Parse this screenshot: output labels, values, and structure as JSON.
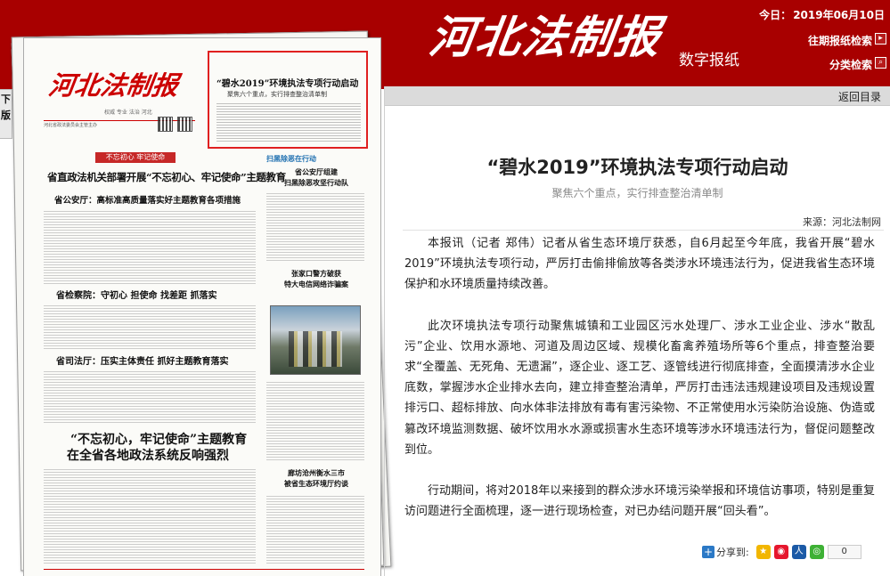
{
  "header": {
    "masthead": "河北法制报",
    "subtitle": "数字报纸",
    "date_label": "今日：",
    "date_value": "2019年06月10日",
    "history_search": "往期报纸检索",
    "category_search": "分类检索"
  },
  "left_tab": "下\n版",
  "newspaper": {
    "masthead": "河北法制报",
    "slogan": "权威 专业 法治 河北",
    "info_line": "河北省政法委员会主管主办",
    "teaser_title": "“碧水2019”环境执法专项行动启动",
    "teaser_subtitle": "聚焦六个重点，实行排查整治清单制",
    "band_left": "不忘初心 牢记使命",
    "band_right": "扫黑除恶在行动",
    "headline_main": "省直政法机关部署开展“不忘初心、牢记使命”主题教育",
    "headline_2": "省公安厅：高标准高质量落实好主题教育各项措施",
    "headline_3": "省检察院：守初心 担使命 找差距 抓落实",
    "headline_4": "省司法厅：压实主体责任 抓好主题教育落实",
    "headline_5": "“不忘初心，牢记使命”主题教育",
    "headline_6": "在全省各地政法系统反响强烈",
    "right_1": "省公安厅组建\n扫黑除恶攻坚行动队",
    "right_2": "张家口警方破获\n特大电信网络诈骗案",
    "right_3": "廊坊沧州衡水三市\n被省生态环境厅约谈"
  },
  "nav": {
    "back_label": "返回目录"
  },
  "article": {
    "title": "“碧水2019”环境执法专项行动启动",
    "subtitle": "聚焦六个重点，实行排查整治清单制",
    "source": "来源：河北法制网",
    "paragraphs": [
      "本报讯（记者 郑伟）记者从省生态环境厅获悉，自6月起至今年底，我省开展“碧水2019”环境执法专项行动，严厉打击偷排偷放等各类涉水环境违法行为，促进我省生态环境保护和水环境质量持续改善。",
      "此次环境执法专项行动聚焦城镇和工业园区污水处理厂、涉水工业企业、涉水“散乱污”企业、饮用水源地、河道及周边区域、规模化畜禽养殖场所等6个重点，排查整治要求“全覆盖、无死角、无遗漏”，逐企业、逐工艺、逐管线进行彻底排查，全面摸清涉水企业底数，掌握涉水企业排水去向，建立排查整治清单，严厉打击违法违规建设项目及违规设置排污口、超标排放、向水体非法排放有毒有害污染物、不正常使用水污染防治设施、伪造或篡改环境监测数据、破坏饮用水水源或损害水生态环境等涉水环境违法行为，督促问题整改到位。",
      "行动期间，将对2018年以来接到的群众涉水环境污染举报和环境信访事项，特别是重复访问题进行全面梳理，逐一进行现场检查，对已办结问题开展“回头看”。"
    ]
  },
  "share": {
    "label": "分享到:",
    "count": "0"
  }
}
